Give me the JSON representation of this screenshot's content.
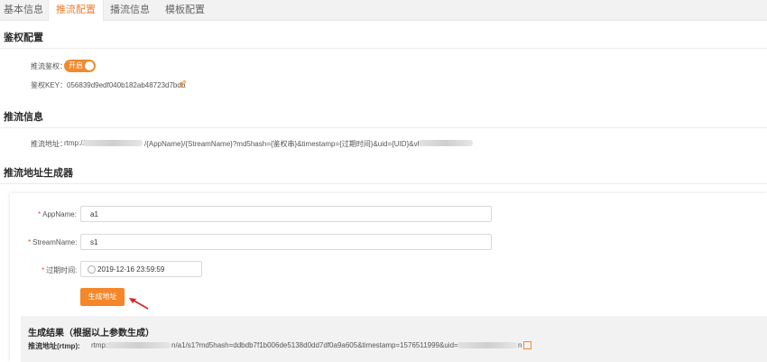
{
  "tabs": [
    {
      "label": "基本信息",
      "active": false
    },
    {
      "label": "推流配置",
      "active": true
    },
    {
      "label": "播流信息",
      "active": false
    },
    {
      "label": "模板配置",
      "active": false
    }
  ],
  "auth": {
    "title": "鉴权配置",
    "toggle_label": "推流鉴权：",
    "toggle_text": "开启",
    "toggle_on": true,
    "key_label": "鉴权KEY：",
    "key_value": "056839d9edf040b182ab48723d7bdb"
  },
  "push_info": {
    "title": "推流信息",
    "address_label": "推流地址：",
    "address_prefix": "rtmp://",
    "address_mid": "/{AppName}/{StreamName}?md5hash={鉴权串}&timestamp={过期时间}&uid={UID}&vhost="
  },
  "generator": {
    "title": "推流地址生成器",
    "appname_label": "AppName:",
    "appname_value": "a1",
    "streamname_label": "StreamName:",
    "streamname_value": "s1",
    "expire_label": "过期时间:",
    "expire_value": "2019-12-16 23:59:59",
    "button_label": "生成地址"
  },
  "result": {
    "title": "生成结果（根据以上参数生成）",
    "label": "推流地址(rtmp):",
    "prefix": "rtmp://",
    "mid": "n/a1/s1?md5hash=ddbdb7f1b006de5138d0dd7df0a9a605&timestamp=1576511999&uid=0&vhost=",
    "suffix": "n"
  },
  "colors": {
    "accent": "#f5862a",
    "required": "#e94b3c",
    "arrow": "#e02020"
  }
}
